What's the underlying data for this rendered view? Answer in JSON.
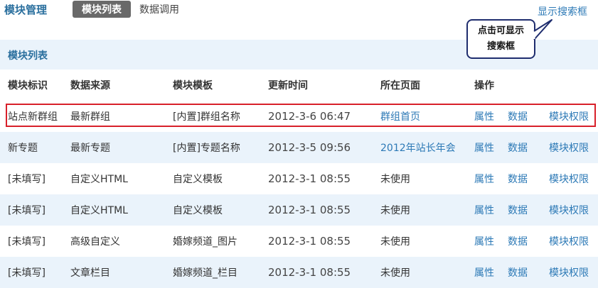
{
  "header": {
    "title": "模块管理",
    "tabs": [
      {
        "label": "模块列表",
        "active": true
      },
      {
        "label": "数据调用",
        "active": false
      }
    ],
    "search_toggle": "显示搜索框"
  },
  "callout": {
    "line1": "点击可显示",
    "line2": "搜索框"
  },
  "section": {
    "title": "模块列表"
  },
  "table": {
    "columns": [
      "模块标识",
      "数据来源",
      "模块模板",
      "更新时间",
      "所在页面",
      "操作"
    ],
    "rows": [
      {
        "id": "站点新群组",
        "source": "最新群组",
        "template": "[内置]群组名称",
        "updated": "2012-3-6 06:47",
        "page": "群组首页",
        "page_is_link": true
      },
      {
        "id": "新专题",
        "source": "最新专题",
        "template": "[内置]专题名称",
        "updated": "2012-3-5 09:56",
        "page": "2012年站长年会",
        "page_is_link": true
      },
      {
        "id": "[未填写]",
        "source": "自定义HTML",
        "template": "自定义模板",
        "updated": "2012-3-1 08:55",
        "page": "未使用",
        "page_is_link": false
      },
      {
        "id": "[未填写]",
        "source": "自定义HTML",
        "template": "自定义模板",
        "updated": "2012-3-1 08:55",
        "page": "未使用",
        "page_is_link": false
      },
      {
        "id": "[未填写]",
        "source": "高级自定义",
        "template": "婚嫁频道_图片",
        "updated": "2012-3-1 08:55",
        "page": "未使用",
        "page_is_link": false
      },
      {
        "id": "[未填写]",
        "source": "文章栏目",
        "template": "婚嫁频道_栏目",
        "updated": "2012-3-1 08:55",
        "page": "未使用",
        "page_is_link": false
      }
    ],
    "actions": [
      "属性",
      "数据",
      "模块权限"
    ]
  },
  "colors": {
    "accent": "#2a6f9e",
    "link": "#2c79b6",
    "row_alt": "#eaf3fb",
    "highlight": "#d8202a",
    "active_tab": "#696969"
  }
}
